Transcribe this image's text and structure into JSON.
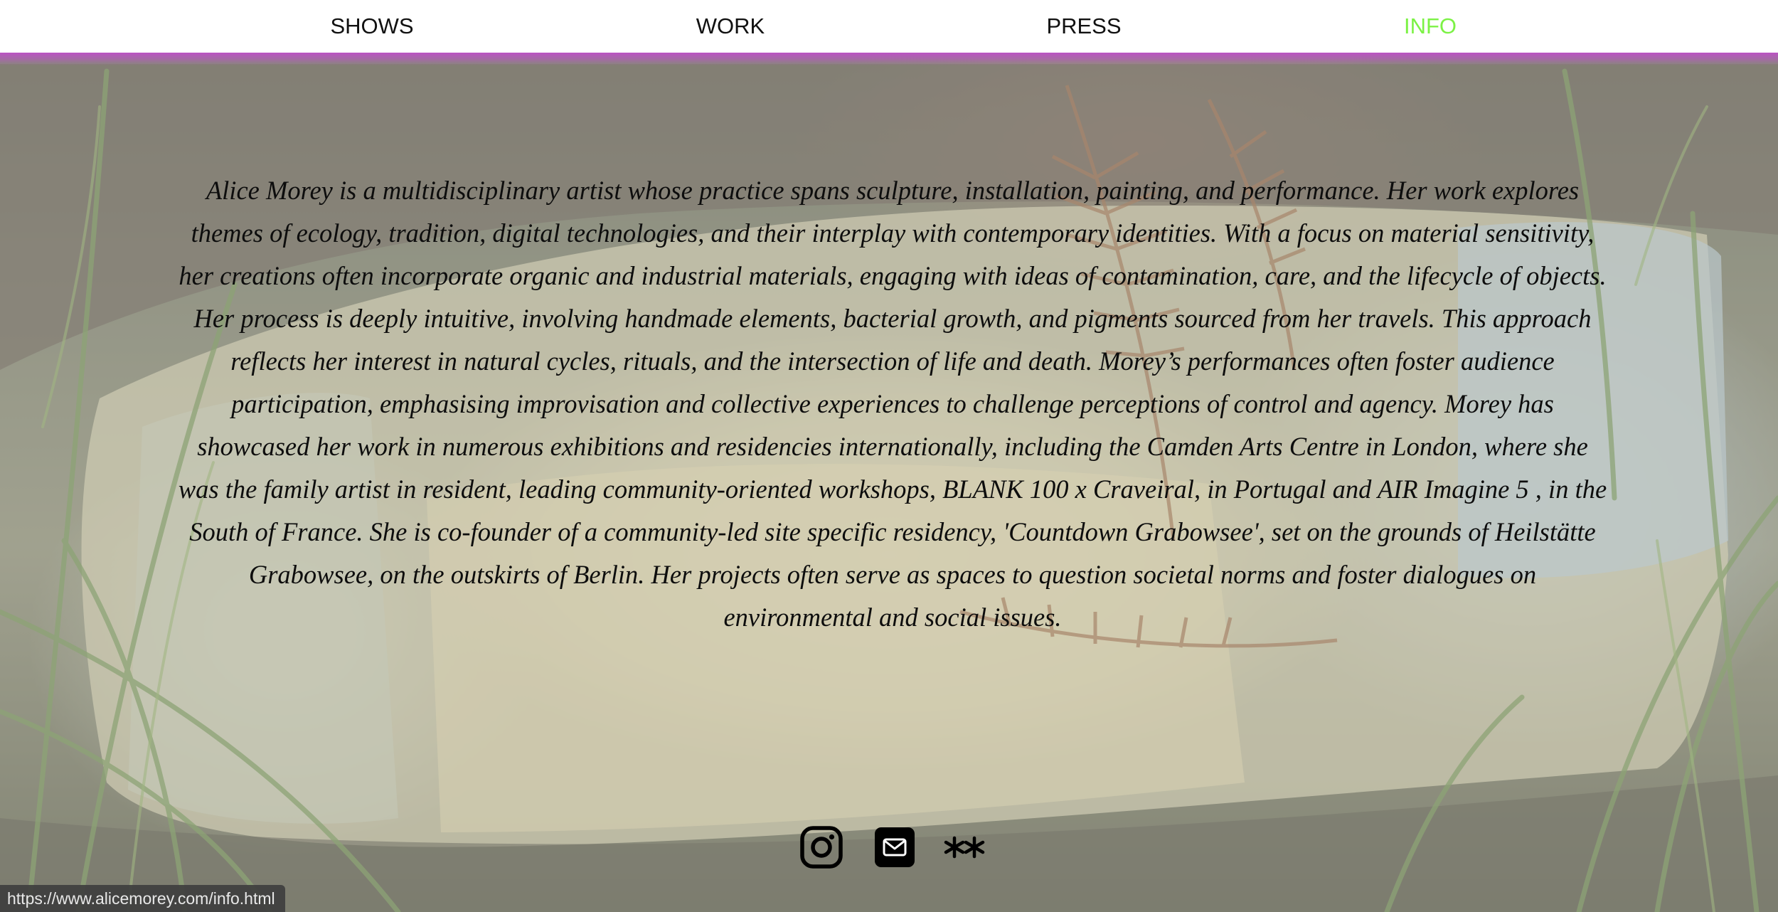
{
  "nav": {
    "items": [
      {
        "label": "SHOWS",
        "active": false
      },
      {
        "label": "WORK",
        "active": false
      },
      {
        "label": "PRESS",
        "active": false
      },
      {
        "label": "INFO",
        "active": true
      }
    ],
    "active_color": "#7cf245",
    "underline_color": "#be50c8"
  },
  "bio": {
    "text": "Alice Morey is a multidisciplinary artist whose practice spans sculpture, installation, painting, and performance. Her work explores themes of ecology, tradition, digital technologies, and their interplay with contemporary identities. With a focus on material sensitivity, her creations often incorporate organic and industrial materials, engaging with ideas of contamination, care, and the lifecycle of objects. Her process is deeply intuitive, involving handmade elements, bacterial growth, and pigments sourced from her travels. This approach reflects her interest in natural cycles, rituals, and the intersection of life and death. Morey’s performances often foster audience participation, emphasising improvisation and collective experiences to challenge perceptions of control and agency. Morey has showcased her work in numerous exhibitions and residencies internationally, including the Camden Arts Centre in London, where she was the family artist in resident, leading community-oriented workshops, BLANK 100 x Craveiral, in Portugal and AIR Imagine 5 , in the South of France. She is co-founder of a community-led site specific residency, 'Countdown Grabowsee', set on the grounds of Heilstätte Grabowsee, on the outskirts of Berlin. Her projects often serve as spaces to question societal norms and foster dialogues on environmental and social issues."
  },
  "social": {
    "icons": [
      "instagram-icon",
      "email-icon",
      "asterisks-icon"
    ]
  },
  "status_bar": {
    "url": "https://www.alicemorey.com/info.html"
  }
}
